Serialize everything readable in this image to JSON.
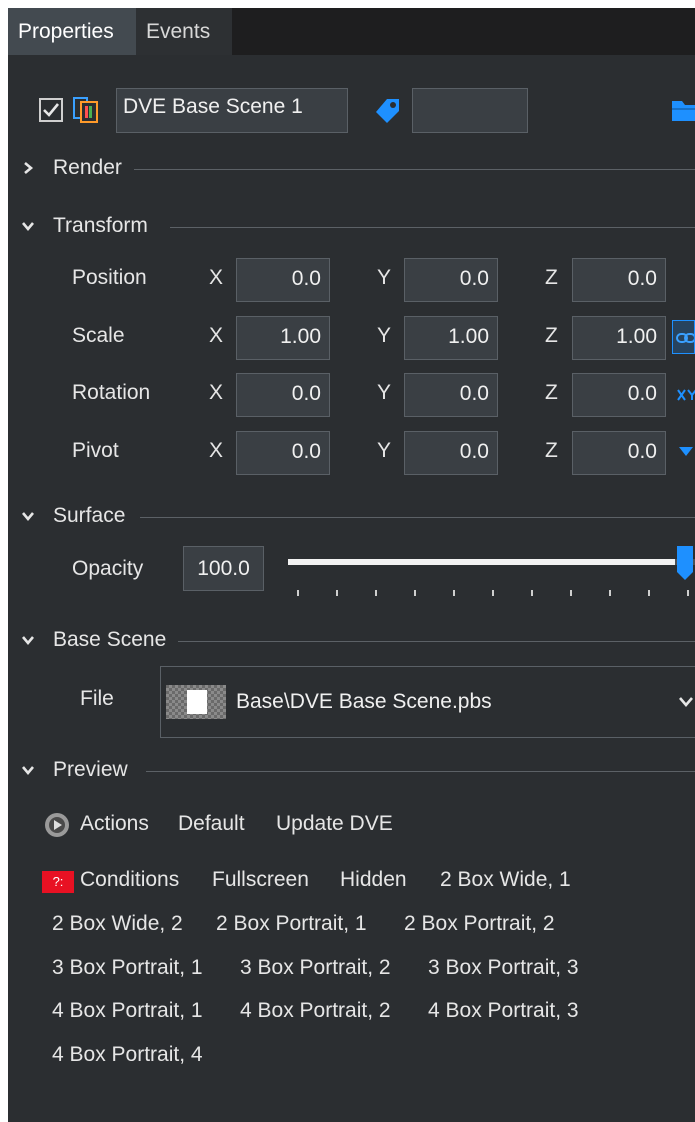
{
  "tabs": [
    {
      "label": "Properties",
      "active": true
    },
    {
      "label": "Events",
      "active": false
    }
  ],
  "object": {
    "enabled": true,
    "name": "DVE Base Scene 1",
    "tag_value": ""
  },
  "sections": {
    "render": {
      "title": "Render",
      "expanded": false
    },
    "transform": {
      "title": "Transform",
      "expanded": true
    },
    "surface": {
      "title": "Surface",
      "expanded": true
    },
    "base_scene": {
      "title": "Base Scene",
      "expanded": true
    },
    "preview": {
      "title": "Preview",
      "expanded": true
    }
  },
  "transform": {
    "axis_labels": [
      "X",
      "Y",
      "Z"
    ],
    "rows": [
      {
        "label": "Position",
        "x": "0.0",
        "y": "0.0",
        "z": "0.0"
      },
      {
        "label": "Scale",
        "x": "1.00",
        "y": "1.00",
        "z": "1.00"
      },
      {
        "label": "Rotation",
        "x": "0.0",
        "y": "0.0",
        "z": "0.0"
      },
      {
        "label": "Pivot",
        "x": "0.0",
        "y": "0.0",
        "z": "0.0"
      }
    ]
  },
  "surface": {
    "opacity_label": "Opacity",
    "opacity_value": "100.0",
    "opacity_fraction": 1.0
  },
  "base_scene": {
    "file_label": "File",
    "file_value": "Base\\DVE Base Scene.pbs"
  },
  "preview": {
    "actions_label": "Actions",
    "actions": [
      "Default",
      "Update DVE"
    ],
    "conditions_badge": "?:",
    "conditions_label": "Conditions",
    "conditions": [
      "Fullscreen",
      "Hidden",
      "2 Box Wide, 1",
      "2 Box Wide, 2",
      "2 Box Portrait, 1",
      "2 Box Portrait, 2",
      "3 Box Portrait, 1",
      "3 Box Portrait, 2",
      "3 Box Portrait, 3",
      "4 Box Portrait, 1",
      "4 Box Portrait, 2",
      "4 Box Portrait, 3",
      "4 Box Portrait, 4"
    ]
  },
  "colors": {
    "accent": "#1e90ff",
    "panel_bg": "#2b2e31",
    "tabbar_bg": "#1e1e1f",
    "badge_red": "#e81123"
  },
  "icons": [
    "checkbox-icon",
    "scene-file-icon",
    "tag-icon",
    "folder-icon",
    "chevron-right-icon",
    "chevron-down-icon",
    "link-icon",
    "xy-icon",
    "pivot-arrow-icon",
    "actions-icon",
    "conditions-badge-icon"
  ]
}
